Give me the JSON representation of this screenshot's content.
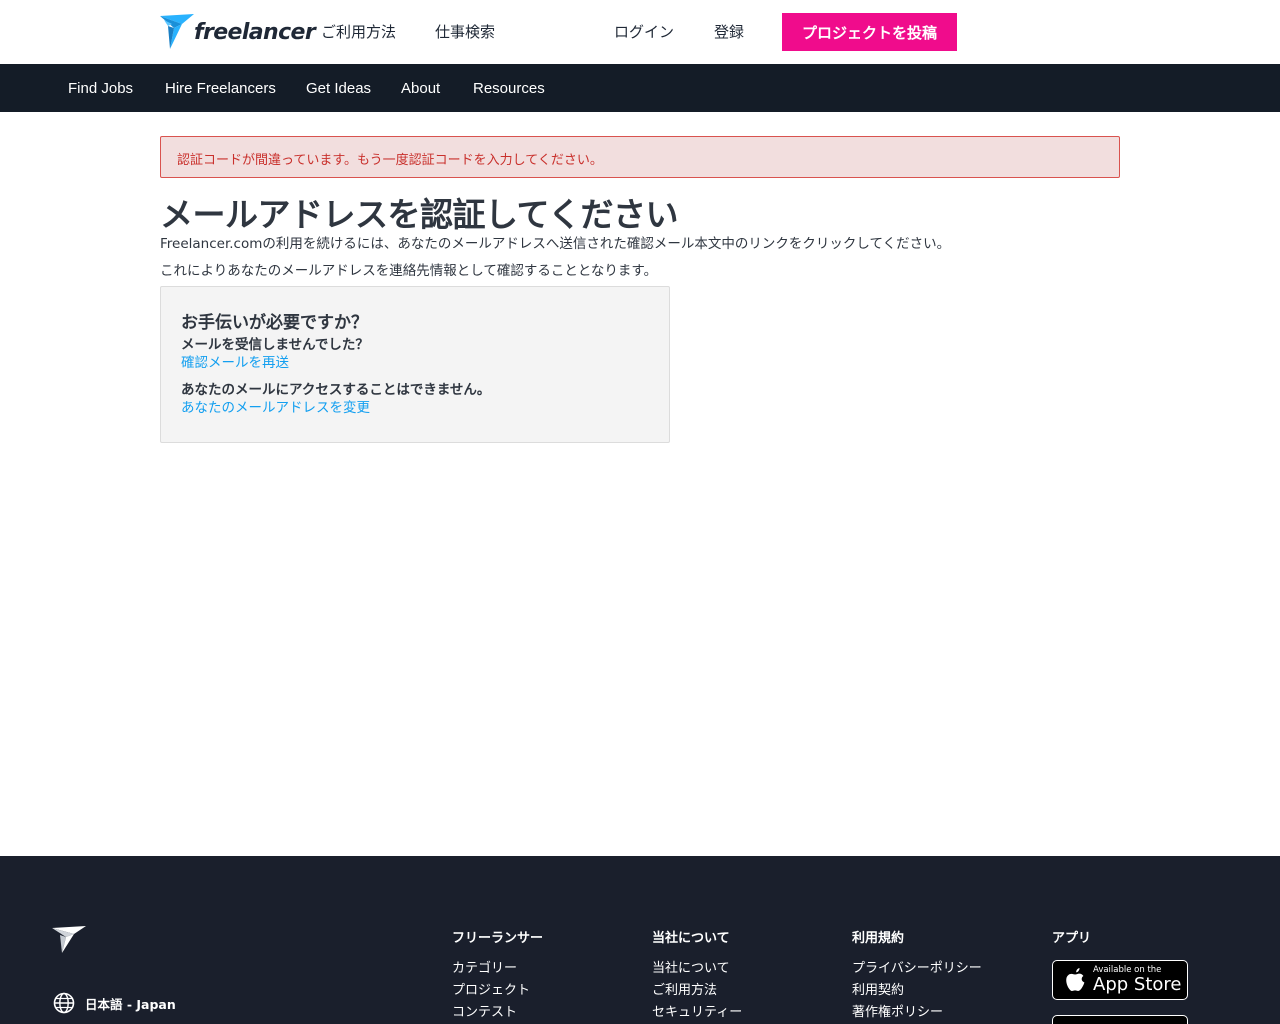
{
  "header": {
    "logo_text": "freelancer",
    "nav": [
      "ご利用方法",
      "仕事検索"
    ],
    "login": "ログイン",
    "signup": "登録",
    "post_project": "プロジェクトを投稿"
  },
  "subnav": {
    "items": [
      "Find Jobs",
      "Hire Freelancers",
      "Get Ideas",
      "About",
      "Resources"
    ]
  },
  "alert": {
    "message": "認証コードが間違っています。もう一度認証コードを入力してください。"
  },
  "main": {
    "title": "メールアドレスを認証してください",
    "description_1": "Freelancer.comの利用を続けるには、あなたのメールアドレスへ送信された確認メール本文中のリンクをクリックしてください。",
    "description_2": "これによりあなたのメールアドレスを連絡先情報として確認することとなります。"
  },
  "help": {
    "title": "お手伝いが必要ですか？",
    "question_1": "メールを受信しませんでした？",
    "link_1": "確認メールを再送",
    "question_2": "あなたのメールにアクセスすることはできません。",
    "link_2": "あなたのメールアドレスを変更"
  },
  "footer": {
    "language": "日本語 - Japan",
    "columns": [
      {
        "heading": "フリーランサー",
        "links": [
          "カテゴリー",
          "プロジェクト",
          "コンテスト"
        ]
      },
      {
        "heading": "当社について",
        "links": [
          "当社について",
          "ご利用方法",
          "セキュリティー"
        ]
      },
      {
        "heading": "利用規約",
        "links": [
          "プライバシーポリシー",
          "利用契約",
          "著作権ポリシー"
        ]
      },
      {
        "heading": "アプリ",
        "links": []
      }
    ],
    "appstore_small": "Available on the",
    "appstore_big": "App Store"
  },
  "colors": {
    "brand_pink": "#f00c8c",
    "brand_blue": "#29b2fe",
    "nav_dark": "#141c27",
    "footer_dark": "#1a1f2c",
    "link_blue": "#139ff0",
    "alert_red": "#c9302c"
  },
  "icons": [
    "freelancer-logo-icon",
    "globe-icon",
    "apple-icon"
  ]
}
